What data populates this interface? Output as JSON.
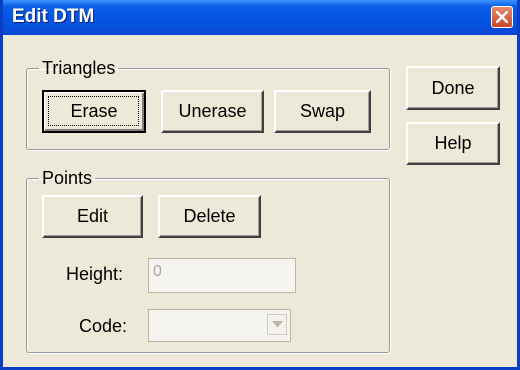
{
  "window": {
    "title": "Edit DTM",
    "close_icon": "close-icon"
  },
  "triangles": {
    "legend": "Triangles",
    "erase_label": "Erase",
    "unerase_label": "Unerase",
    "swap_label": "Swap"
  },
  "side_buttons": {
    "done_label": "Done",
    "help_label": "Help"
  },
  "points": {
    "legend": "Points",
    "edit_label": "Edit",
    "delete_label": "Delete",
    "height_label": "Height:",
    "height_value": "0",
    "code_label": "Code:",
    "code_value": "",
    "dropdown_icon": "chevron-down-icon"
  },
  "colors": {
    "titlebar": "#0454e3",
    "dialog_bg": "#ece9d8",
    "close_button": "#c8462c"
  }
}
